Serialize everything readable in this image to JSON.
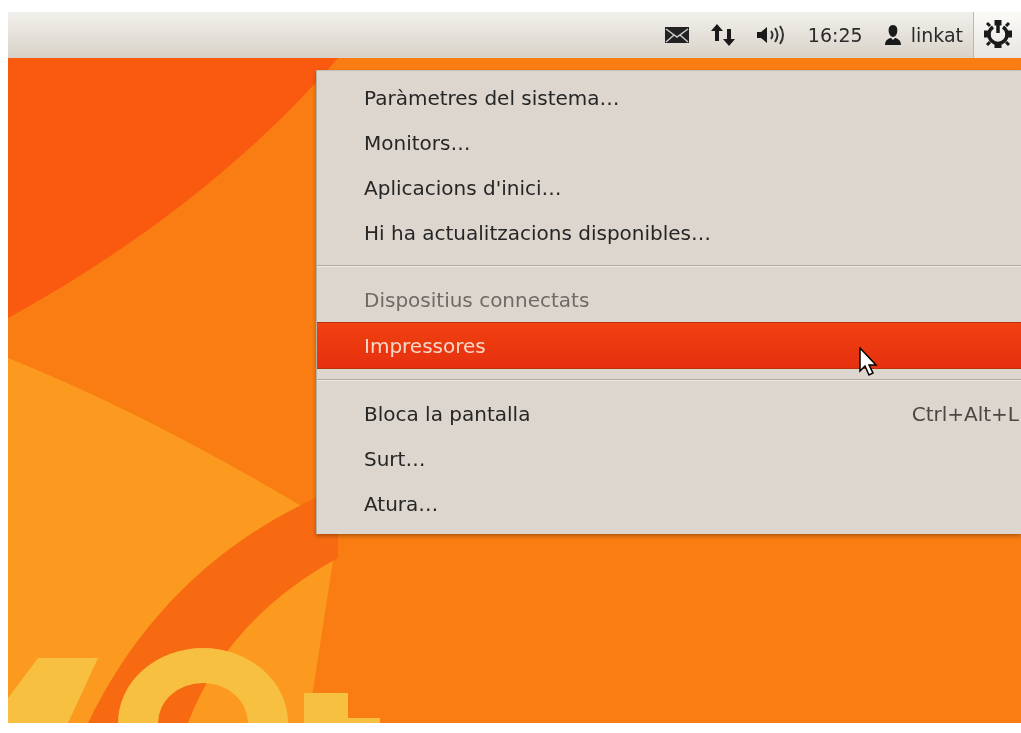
{
  "top_bar": {
    "clock": "16:25",
    "user": "linkat",
    "session_button": {
      "selected": true
    }
  },
  "menu": {
    "sections": [
      [
        {
          "label": "Paràmetres del sistema…",
          "disabled": false,
          "selected": false
        },
        {
          "label": "Monitors…",
          "disabled": false,
          "selected": false
        },
        {
          "label": "Aplicacions d'inici…",
          "disabled": false,
          "selected": false
        },
        {
          "label": "Hi ha actualitzacions disponibles…",
          "disabled": false,
          "selected": false
        }
      ],
      [
        {
          "label": "Dispositius connectats",
          "disabled": true,
          "selected": false
        },
        {
          "label": "Impressores",
          "disabled": false,
          "selected": true
        }
      ],
      [
        {
          "label": "Bloca la pantalla",
          "shortcut": "Ctrl+Alt+L",
          "disabled": false,
          "selected": false
        },
        {
          "label": "Surt…",
          "disabled": false,
          "selected": false
        },
        {
          "label": "Atura…",
          "disabled": false,
          "selected": false
        }
      ]
    ]
  }
}
